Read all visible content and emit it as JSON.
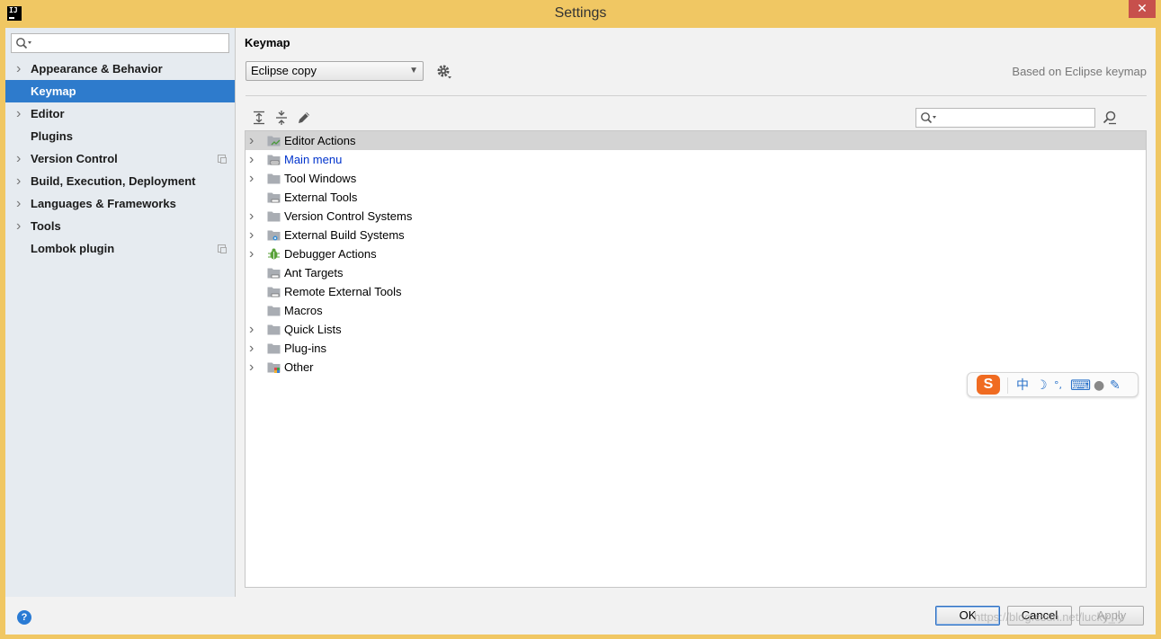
{
  "window": {
    "app_icon_text": "IJ",
    "title": "Settings",
    "close_glyph": "✕"
  },
  "sidebar": {
    "search_placeholder": "",
    "items": [
      {
        "label": "Appearance & Behavior",
        "expandable": true
      },
      {
        "label": "Keymap",
        "expandable": false,
        "selected": true
      },
      {
        "label": "Editor",
        "expandable": true
      },
      {
        "label": "Plugins",
        "expandable": false
      },
      {
        "label": "Version Control",
        "expandable": true,
        "project_icon": true
      },
      {
        "label": "Build, Execution, Deployment",
        "expandable": true
      },
      {
        "label": "Languages & Frameworks",
        "expandable": true
      },
      {
        "label": "Tools",
        "expandable": true
      },
      {
        "label": "Lombok plugin",
        "expandable": false,
        "project_icon": true
      }
    ]
  },
  "keymap": {
    "title": "Keymap",
    "selected_keymap": "Eclipse copy",
    "based_on": "Based on Eclipse keymap",
    "search_placeholder": ""
  },
  "tree": {
    "rows": [
      {
        "label": "Editor Actions",
        "expandable": true,
        "selected": true,
        "icon": "folder-chart-icon"
      },
      {
        "label": "Main menu",
        "expandable": true,
        "link": true,
        "icon": "folder-menu-icon"
      },
      {
        "label": "Tool Windows",
        "expandable": true,
        "icon": "folder-icon"
      },
      {
        "label": "External Tools",
        "expandable": false,
        "icon": "folder-tools-icon"
      },
      {
        "label": "Version Control Systems",
        "expandable": true,
        "icon": "folder-icon"
      },
      {
        "label": "External Build Systems",
        "expandable": true,
        "icon": "folder-gear-icon"
      },
      {
        "label": "Debugger Actions",
        "expandable": true,
        "icon": "bug-icon"
      },
      {
        "label": "Ant Targets",
        "expandable": false,
        "icon": "folder-tools-icon"
      },
      {
        "label": "Remote External Tools",
        "expandable": false,
        "icon": "folder-tools-icon"
      },
      {
        "label": "Macros",
        "expandable": false,
        "icon": "folder-icon"
      },
      {
        "label": "Quick Lists",
        "expandable": true,
        "icon": "folder-icon"
      },
      {
        "label": "Plug-ins",
        "expandable": true,
        "icon": "folder-icon"
      },
      {
        "label": "Other",
        "expandable": true,
        "icon": "folder-grid-icon"
      }
    ]
  },
  "ime": {
    "logo": "S",
    "mode": "中",
    "moon": "☽",
    "punct": "°,",
    "keyboard": "⌨",
    "user": "●",
    "wrench": "✎"
  },
  "buttons": {
    "ok": "OK",
    "cancel": "Cancel",
    "apply": "Apply",
    "help": "?"
  },
  "watermark": "https://blog.csdn.net/lucky_ly",
  "colors": {
    "title_bar": "#f0c763",
    "selection": "#2e7bcc",
    "link": "#0033cc"
  }
}
